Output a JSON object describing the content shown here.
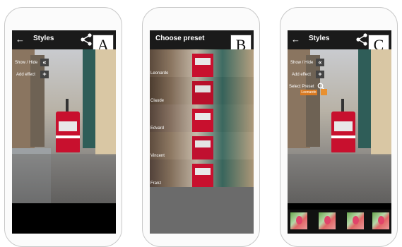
{
  "panels": {
    "a": {
      "label": "A",
      "title": "Styles",
      "show_hide": "Show / Hide",
      "add_effect": "Add effect"
    },
    "b": {
      "label": "B",
      "title": "Choose preset",
      "presets": [
        "Leonardo",
        "Claude",
        "Edvard",
        "Vincent",
        "Franz"
      ]
    },
    "c": {
      "label": "C",
      "title": "Styles",
      "show_hide": "Show / Hide",
      "add_effect": "Add effect",
      "select_preset": "Select Preset",
      "preset_badge": "Leonardo",
      "thumbnail_count": 4
    }
  },
  "icons": {
    "back": "arrow-left-icon",
    "share": "share-icon",
    "collapse": "double-chevron-left-icon",
    "add": "plus-icon",
    "search": "search-icon"
  },
  "colors": {
    "appbar": "#1a1a1a",
    "tram": "#c8102e",
    "preset_accent": "#d97a22"
  }
}
